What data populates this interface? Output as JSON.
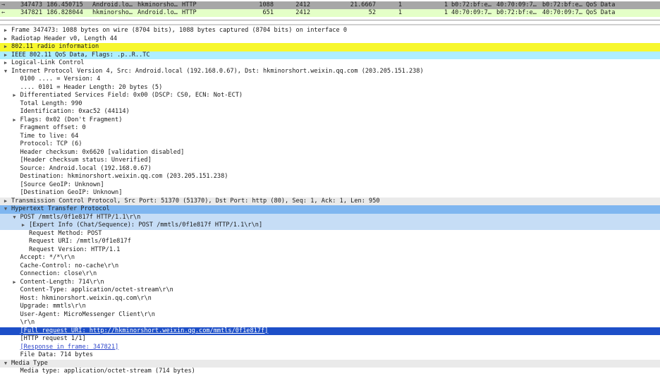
{
  "packet_list": {
    "rows": [
      {
        "no": "347473",
        "time": "186.450715",
        "source": "Android.lo…",
        "destination": "hkminorsho…",
        "protocol": "HTTP",
        "length": "1088",
        "channel": "2412",
        "value": "21.6667",
        "a": "1",
        "b": "1",
        "c": "b0:72:bf:e…",
        "d": "40:70:09:7…",
        "e": "b0:72:bf:e…",
        "info": "QoS Data"
      },
      {
        "no": "347821",
        "time": "186.828044",
        "source": "hkminorsho…",
        "destination": "Android.lo…",
        "protocol": "HTTP",
        "length": "651",
        "channel": "2412",
        "value": "52",
        "a": "1",
        "b": "1",
        "c": "40:70:09:7…",
        "d": "b0:72:bf:e…",
        "e": "40:70:09:7…",
        "info": "QoS Data"
      }
    ]
  },
  "details": [
    {
      "text": "Frame 347473: 1088 bytes on wire (8704 bits), 1088 bytes captured (8704 bits) on interface 0",
      "toggle": "▶"
    },
    {
      "text": "Radiotap Header v0, Length 44",
      "toggle": "▶"
    },
    {
      "text": "802.11 radio information",
      "toggle": "▶"
    },
    {
      "text": "IEEE 802.11 QoS Data, Flags: .p..R..TC",
      "toggle": "▶"
    },
    {
      "text": "Logical-Link Control",
      "toggle": "▶"
    },
    {
      "text": "Internet Protocol Version 4, Src: Android.local (192.168.0.67), Dst: hkminorshort.weixin.qq.com (203.205.151.238)",
      "toggle": "▼"
    },
    {
      "text": "0100 .... = Version: 4",
      "toggle": ""
    },
    {
      "text": ".... 0101 = Header Length: 20 bytes (5)",
      "toggle": ""
    },
    {
      "text": "Differentiated Services Field: 0x00 (DSCP: CS0, ECN: Not-ECT)",
      "toggle": "▶"
    },
    {
      "text": "Total Length: 990",
      "toggle": ""
    },
    {
      "text": "Identification: 0xac52 (44114)",
      "toggle": ""
    },
    {
      "text": "Flags: 0x02 (Don't Fragment)",
      "toggle": "▶"
    },
    {
      "text": "Fragment offset: 0",
      "toggle": ""
    },
    {
      "text": "Time to live: 64",
      "toggle": ""
    },
    {
      "text": "Protocol: TCP (6)",
      "toggle": ""
    },
    {
      "text": "Header checksum: 0x6620 [validation disabled]",
      "toggle": ""
    },
    {
      "text": "[Header checksum status: Unverified]",
      "toggle": ""
    },
    {
      "text": "Source: Android.local (192.168.0.67)",
      "toggle": ""
    },
    {
      "text": "Destination: hkminorshort.weixin.qq.com (203.205.151.238)",
      "toggle": ""
    },
    {
      "text": "[Source GeoIP: Unknown]",
      "toggle": ""
    },
    {
      "text": "[Destination GeoIP: Unknown]",
      "toggle": ""
    },
    {
      "text": "Transmission Control Protocol, Src Port: 51370 (51370), Dst Port: http (80), Seq: 1, Ack: 1, Len: 950",
      "toggle": "▶"
    },
    {
      "text": "Hypertext Transfer Protocol",
      "toggle": "▼"
    },
    {
      "text": "POST /mmtls/0f1e817f HTTP/1.1\\r\\n",
      "toggle": "▼"
    },
    {
      "text": "[Expert Info (Chat/Sequence): POST /mmtls/0f1e817f HTTP/1.1\\r\\n]",
      "toggle": "▶"
    },
    {
      "text": "Request Method: POST",
      "toggle": ""
    },
    {
      "text": "Request URI: /mmtls/0f1e817f",
      "toggle": ""
    },
    {
      "text": "Request Version: HTTP/1.1",
      "toggle": ""
    },
    {
      "text": "Accept: */*\\r\\n",
      "toggle": ""
    },
    {
      "text": "Cache-Control: no-cache\\r\\n",
      "toggle": ""
    },
    {
      "text": "Connection: close\\r\\n",
      "toggle": ""
    },
    {
      "text": "Content-Length: 714\\r\\n",
      "toggle": "▶"
    },
    {
      "text": "Content-Type: application/octet-stream\\r\\n",
      "toggle": ""
    },
    {
      "text": "Host: hkminorshort.weixin.qq.com\\r\\n",
      "toggle": ""
    },
    {
      "text": "Upgrade: mmtls\\r\\n",
      "toggle": ""
    },
    {
      "text": "User-Agent: MicroMessenger Client\\r\\n",
      "toggle": ""
    },
    {
      "text": "\\r\\n",
      "toggle": ""
    },
    {
      "text": "[Full request URI: http://hkminorshort.weixin.qq.com/mmtls/0f1e817f]",
      "toggle": ""
    },
    {
      "text": "[HTTP request 1/1]",
      "toggle": ""
    },
    {
      "text": "[Response in frame: 347821]",
      "toggle": ""
    },
    {
      "text": "File Data: 714 bytes",
      "toggle": ""
    },
    {
      "text": "Media Type",
      "toggle": "▼"
    },
    {
      "text": "Media type: application/octet-stream (714 bytes)",
      "toggle": ""
    }
  ],
  "colors": {
    "selected_row": "#1d4fc8",
    "http_header": "#7fb6f0",
    "radio_info": "#f7f72d",
    "qos_data": "#aeeeff",
    "packet_row_alt": "#e4ffc7"
  }
}
